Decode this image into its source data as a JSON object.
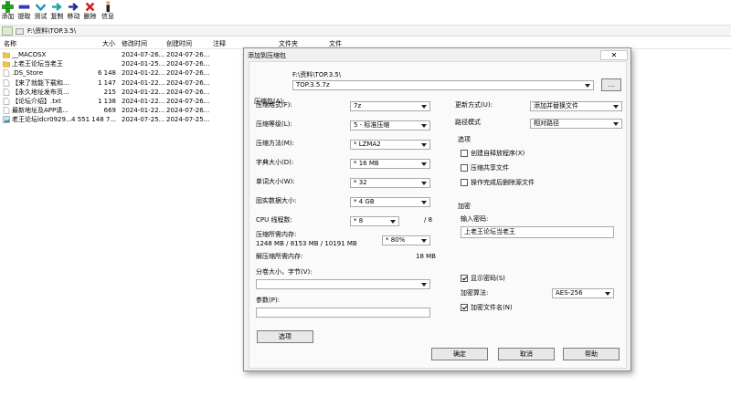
{
  "toolbar": {
    "add": "添加",
    "extract": "提取",
    "test": "测试",
    "copy": "复制",
    "move": "移动",
    "delete": "删除",
    "info": "信息"
  },
  "address": {
    "path": "F:\\资料\\TOP.3.5\\"
  },
  "columns": {
    "name": "名称",
    "size": "大小",
    "modified": "修改时间",
    "created": "创建时间",
    "comment": "注释",
    "folders": "文件夹",
    "files": "文件"
  },
  "files": [
    {
      "name": "__MACOSX",
      "size": "",
      "modified": "2024-07-26...",
      "created": "2024-07-26...",
      "type": "folder"
    },
    {
      "name": "上老王论坛当老王",
      "size": "",
      "modified": "2024-01-25...",
      "created": "2024-07-26...",
      "type": "folder"
    },
    {
      "name": ".DS_Store",
      "size": "6 148",
      "modified": "2024-01-22...",
      "created": "2024-07-26...",
      "type": "file"
    },
    {
      "name": "【来了就能下载和...",
      "size": "1 147",
      "modified": "2024-01-22...",
      "created": "2024-07-26...",
      "type": "file"
    },
    {
      "name": "【永久地址发布页...",
      "size": "215",
      "modified": "2024-01-22...",
      "created": "2024-07-26...",
      "type": "file"
    },
    {
      "name": "【论坛介绍】.txt",
      "size": "1 138",
      "modified": "2024-01-22...",
      "created": "2024-07-26...",
      "type": "file"
    },
    {
      "name": "最新地址及APP请...",
      "size": "669",
      "modified": "2024-01-22...",
      "created": "2024-07-26...",
      "type": "file"
    },
    {
      "name": "老王论坛ldcr0929...",
      "size": "4 551 148 7...",
      "modified": "2024-07-25...",
      "created": "2024-07-25...",
      "type": "image"
    }
  ],
  "dialog": {
    "title": "添加到压缩包",
    "close": "✕",
    "archive_label": "压缩包(A):",
    "archive_dir": "F:\\资料\\TOP.3.5\\",
    "archive_name": "TOP.3.5.7z",
    "browse": "...",
    "format_label": "压缩格式(F):",
    "format_value": "7z",
    "level_label": "压缩等级(L):",
    "level_value": "5 - 标准压缩",
    "method_label": "压缩方法(M):",
    "method_value": "* LZMA2",
    "dict_label": "字典大小(D):",
    "dict_value": "* 16 MB",
    "word_label": "单词大小(W):",
    "word_value": "* 32",
    "solid_label": "固实数据大小:",
    "solid_value": "* 4 GB",
    "cpu_label": "CPU 线程数:",
    "cpu_value": "* 8",
    "cpu_max": "/ 8",
    "mem_label": "压缩所需内存:",
    "mem_detail": "1248 MB / 8153 MB / 10191 MB",
    "mem_value": "* 80%",
    "decomp_label": "解压缩所需内存:",
    "decomp_value": "18 MB",
    "split_label": "分卷大小，字节(V):",
    "split_value": "",
    "params_label": "参数(P):",
    "params_value": "",
    "options_button": "选项",
    "update_label": "更新方式(U):",
    "update_value": "添加并替换文件",
    "pathmode_label": "路径模式",
    "pathmode_value": "相对路径",
    "options_group": "选项",
    "sfx_label": "创建自释放程序(X)",
    "shared_label": "压缩共享文件",
    "deleteafter_label": "操作完成后删除源文件",
    "encryption_group": "加密",
    "password_label": "输入密码:",
    "password_value": "上老王论坛当老王",
    "show_password_label": "显示密码(S)",
    "enc_method_label": "加密算法:",
    "enc_method_value": "AES-256",
    "enc_names_label": "加密文件名(N)",
    "ok": "确定",
    "cancel": "取消",
    "help": "帮助"
  }
}
